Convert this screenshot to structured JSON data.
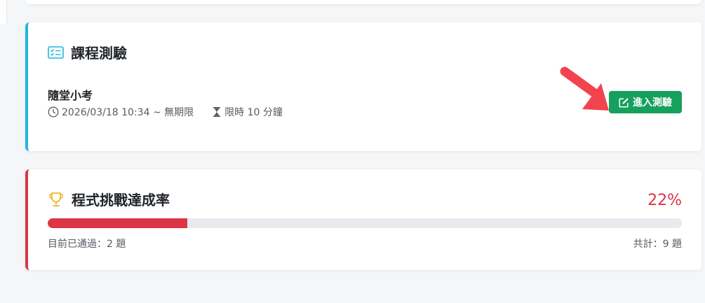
{
  "quiz_section": {
    "title": "課程測驗",
    "quiz": {
      "name": "隨堂小考",
      "time_range": "2026/03/18 10:34 ~ 無期限",
      "time_limit": "限時 10 分鐘",
      "enter_label": "進入測驗"
    }
  },
  "challenge_section": {
    "title": "程式挑戰達成率",
    "percent_label": "22%",
    "progress": 0.22,
    "passed_text": "目前已通過：2 題",
    "total_text": "共計：9 題"
  },
  "colors": {
    "quiz_accent": "#1fb6e0",
    "challenge_accent": "#dc3545",
    "button_green": "#16a05d",
    "trophy": "#f0b429",
    "arrow_red": "#f2434f"
  },
  "icons": {
    "quiz": "checklist-icon",
    "clock": "clock-icon",
    "hourglass": "hourglass-icon",
    "edit": "edit-icon",
    "trophy": "trophy-icon",
    "arrow": "pointer-arrow-icon"
  }
}
